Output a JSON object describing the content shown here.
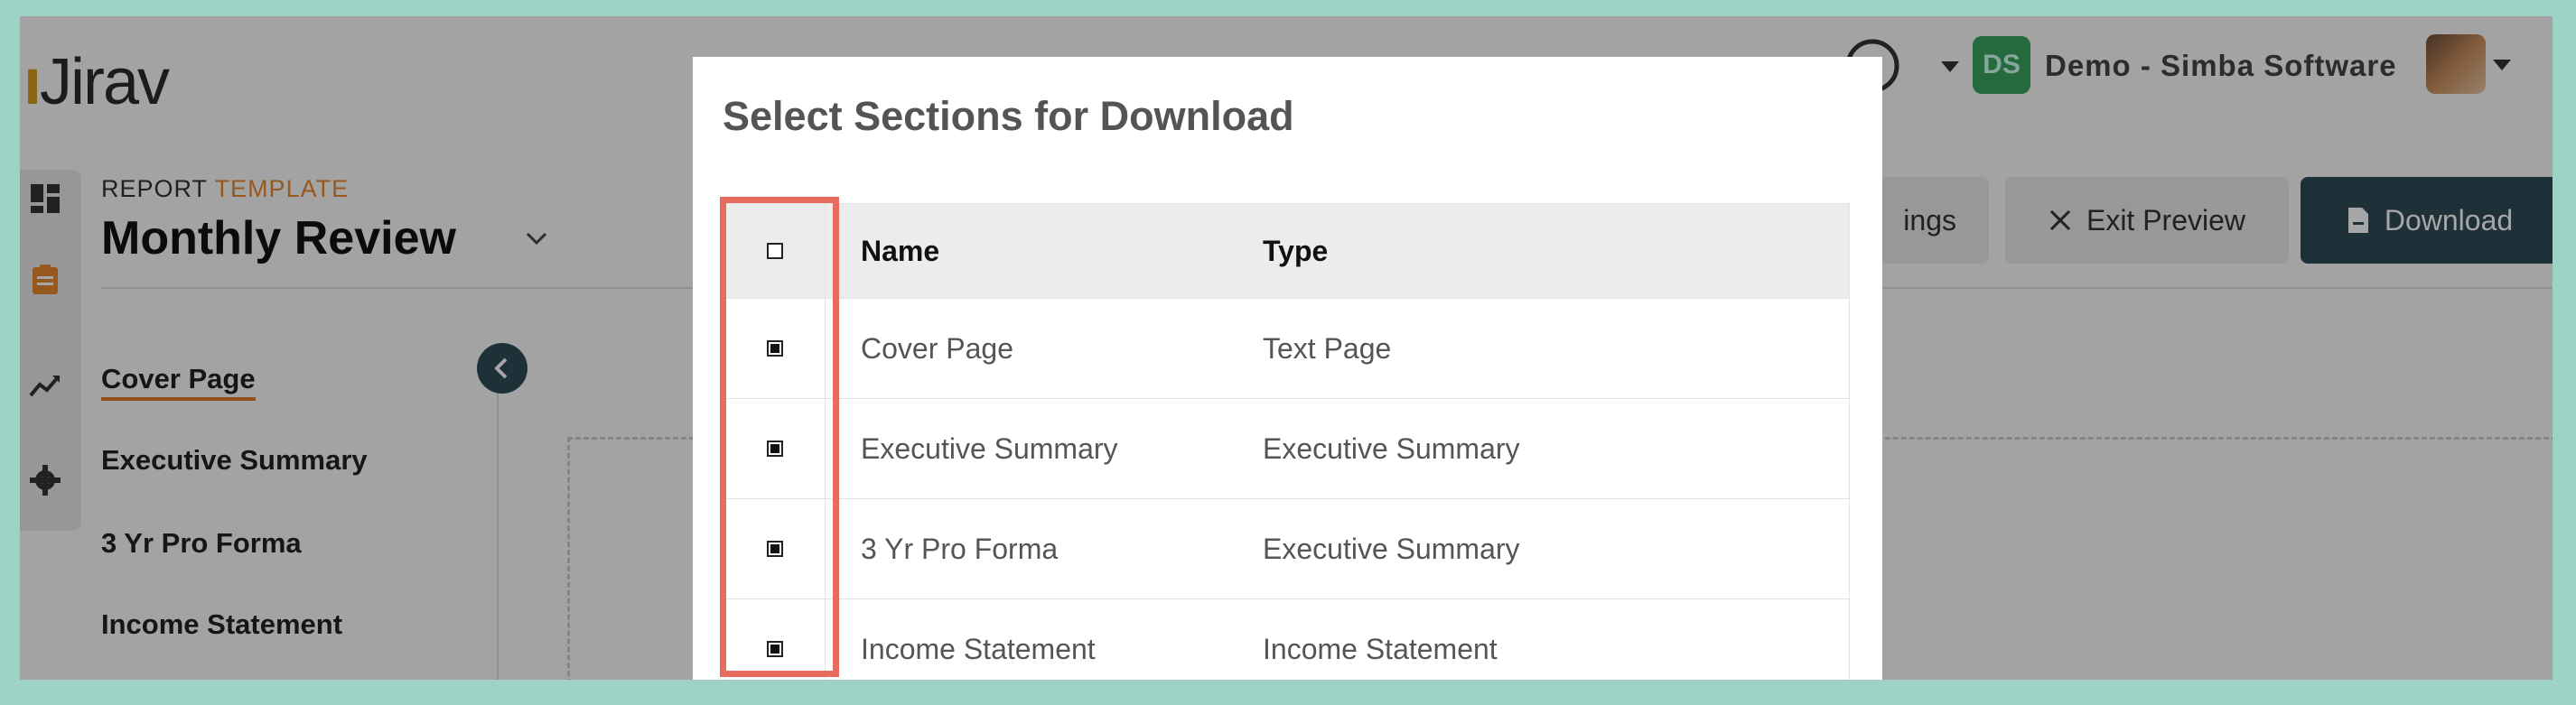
{
  "app": {
    "logo_text": "Jirav"
  },
  "report": {
    "type_label": "REPORT",
    "type_accent": "TEMPLATE",
    "title": "Monthly Review"
  },
  "account": {
    "initials": "DS",
    "org_name": "Demo - Simba Software"
  },
  "toolbar": {
    "settings_partial": "ings",
    "exit_preview": "Exit Preview",
    "download": "Download"
  },
  "sections_nav": [
    {
      "label": "Cover Page",
      "active": true
    },
    {
      "label": "Executive Summary",
      "active": false
    },
    {
      "label": "3 Yr Pro Forma",
      "active": false
    },
    {
      "label": "Income Statement",
      "active": false
    }
  ],
  "modal": {
    "title": "Select Sections for Download",
    "columns": {
      "name": "Name",
      "type": "Type"
    },
    "rows": [
      {
        "name": "Cover Page",
        "type": "Text Page",
        "checked": true
      },
      {
        "name": "Executive Summary",
        "type": "Executive Summary",
        "checked": true
      },
      {
        "name": "3 Yr Pro Forma",
        "type": "Executive Summary",
        "checked": true
      },
      {
        "name": "Income Statement",
        "type": "Income Statement",
        "checked": true
      }
    ]
  },
  "colors": {
    "accent": "#e8882f",
    "dark_button": "#2e4a57",
    "highlight": "#e96b5f",
    "avatar": "#3aa45c"
  },
  "icons": [
    "dashboard-icon",
    "report-icon",
    "trend-icon",
    "gear-icon",
    "help-icon",
    "chevron-down-icon",
    "chevron-left-icon",
    "close-icon",
    "document-icon"
  ]
}
